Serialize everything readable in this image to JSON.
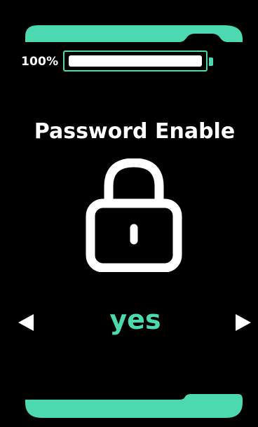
{
  "battery": {
    "percent_label": "100%",
    "level": 1.0
  },
  "screen": {
    "title": "Password Enable",
    "icon": "lock-icon",
    "value": "yes"
  },
  "colors": {
    "accent": "#4cd9b0",
    "background": "#000000",
    "text": "#ffffff"
  }
}
